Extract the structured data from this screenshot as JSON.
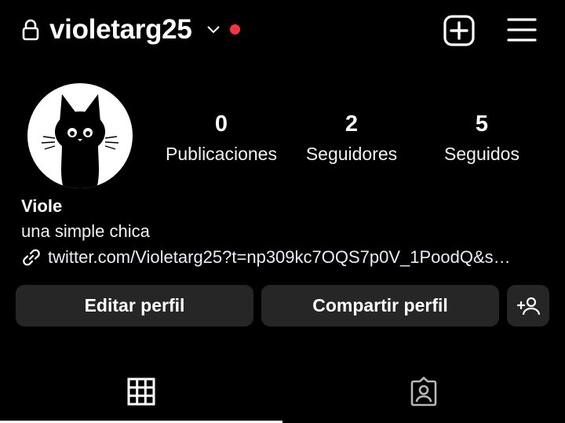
{
  "header": {
    "username": "violetarg25",
    "lock_icon": "lock-icon",
    "dropdown_icon": "chevron-down-icon",
    "notification_dot_color": "#ff3040",
    "new_post_icon": "add-square-icon",
    "menu_icon": "hamburger-menu-icon"
  },
  "profile": {
    "avatar_icon": "black-cat-avatar",
    "stats": [
      {
        "value": "0",
        "label": "Publicaciones"
      },
      {
        "value": "2",
        "label": "Seguidores"
      },
      {
        "value": "5",
        "label": "Seguidos"
      }
    ],
    "display_name": "Viole",
    "bio": "una simple chica",
    "link": "twitter.com/Violetarg25?t=np309kc7OQS7p0V_1PoodQ&s…",
    "link_icon": "link-icon"
  },
  "actions": {
    "edit_label": "Editar perfil",
    "share_label": "Compartir perfil",
    "add_person_icon": "add-person-icon"
  },
  "tabs": [
    {
      "icon": "grid-icon",
      "active": true
    },
    {
      "icon": "tagged-person-icon",
      "active": false
    }
  ],
  "colors": {
    "background": "#000000",
    "button_bg": "#262626",
    "accent_red": "#ff3040",
    "tagged_icon": "#b8b8b8"
  }
}
